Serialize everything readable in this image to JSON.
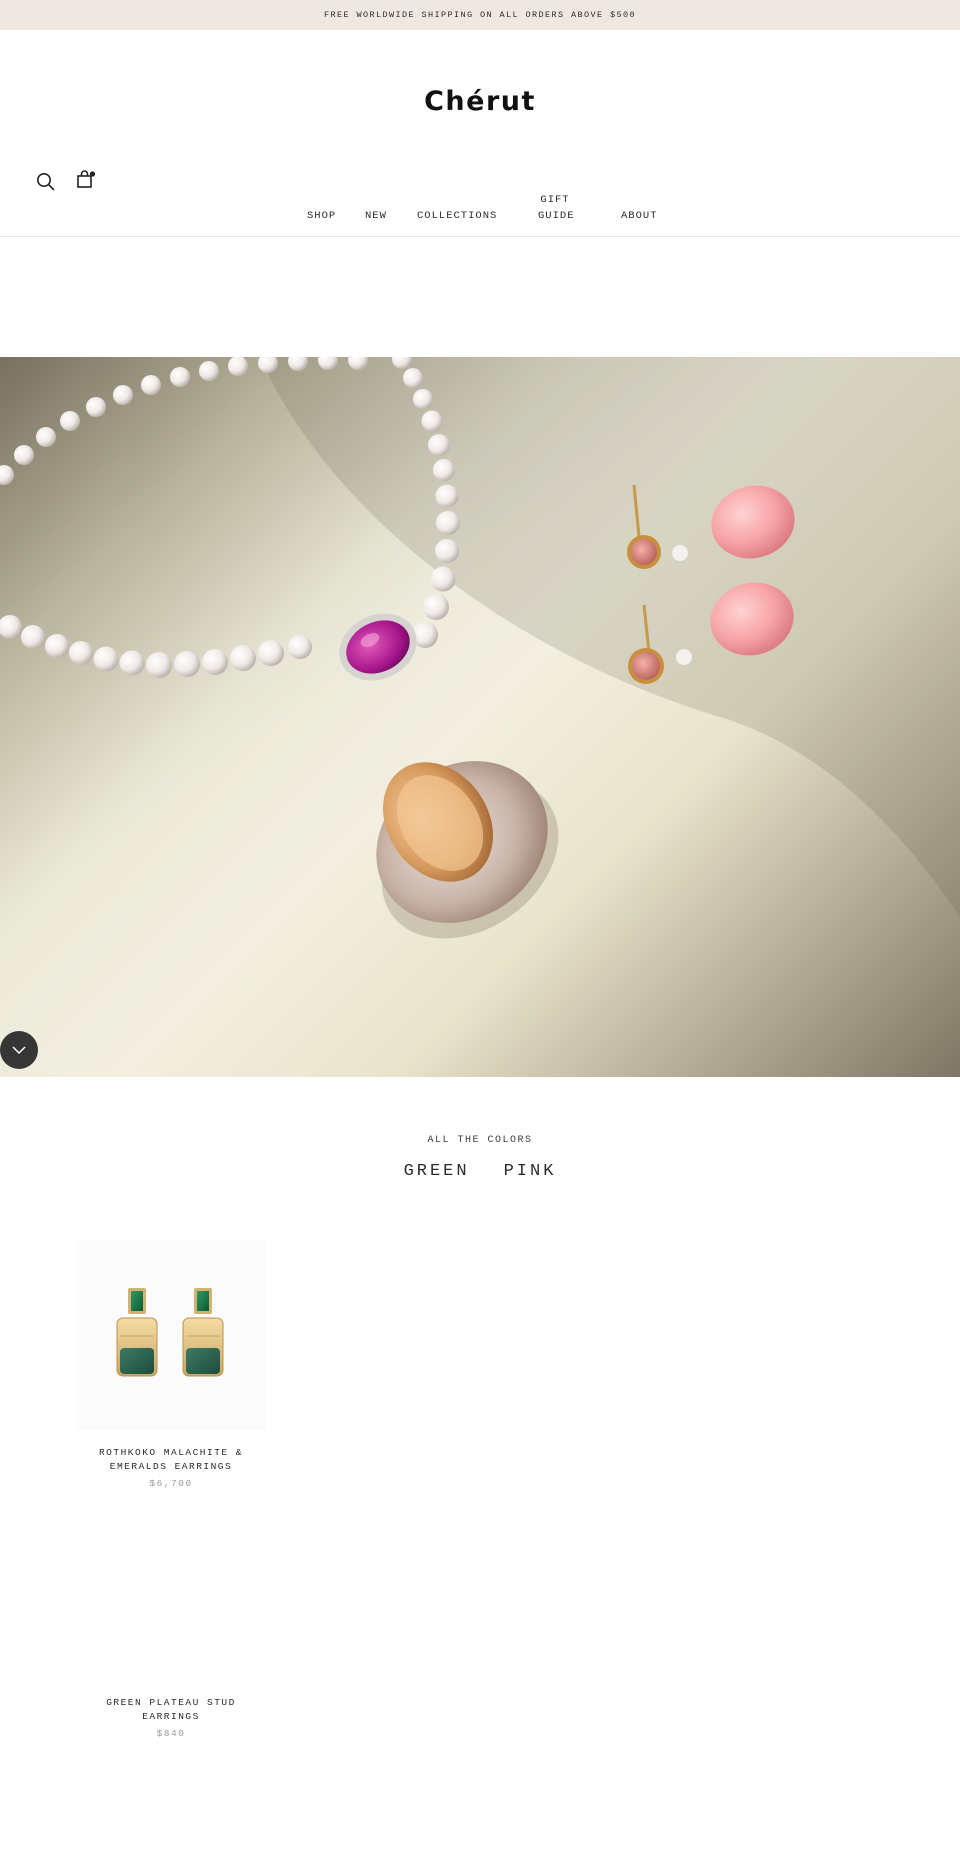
{
  "announcement": {
    "text": "FREE WORLDWIDE SHIPPING ON ALL ORDERS ABOVE $500"
  },
  "brand": {
    "logo_text": "Chérut"
  },
  "header": {
    "icons": [
      "search-icon",
      "shopping-bag-icon"
    ]
  },
  "nav": {
    "items": [
      {
        "label": "SHOP"
      },
      {
        "label": "NEW"
      },
      {
        "label": "COLLECTIONS"
      },
      {
        "label": "GIFT\nGUIDE"
      },
      {
        "label": "ABOUT"
      }
    ]
  },
  "hero": {
    "image": "jewelry-flatlay-pearl-necklace-pink-earrings-pave-ring",
    "scroll_icon": "chevron-down-icon"
  },
  "collection": {
    "eyebrow": "ALL THE COLORS",
    "tabs": [
      {
        "label": "GREEN"
      },
      {
        "label": "PINK"
      }
    ]
  },
  "products": [
    {
      "title": "ROTHKOKO MALACHITE & EMERALDS EARRINGS",
      "price": "$6,700",
      "image": "emerald-malachite-drop-earrings"
    },
    {
      "title": "GREEN PLATEAU STUD EARRINGS",
      "price": "$840",
      "image": "green-plateau-stud-earrings"
    }
  ],
  "colors": {
    "announcement_bg": "#efe7e2",
    "text": "#2b2b2b",
    "price": "#9a9a9a",
    "scroll_button": "#363636"
  }
}
